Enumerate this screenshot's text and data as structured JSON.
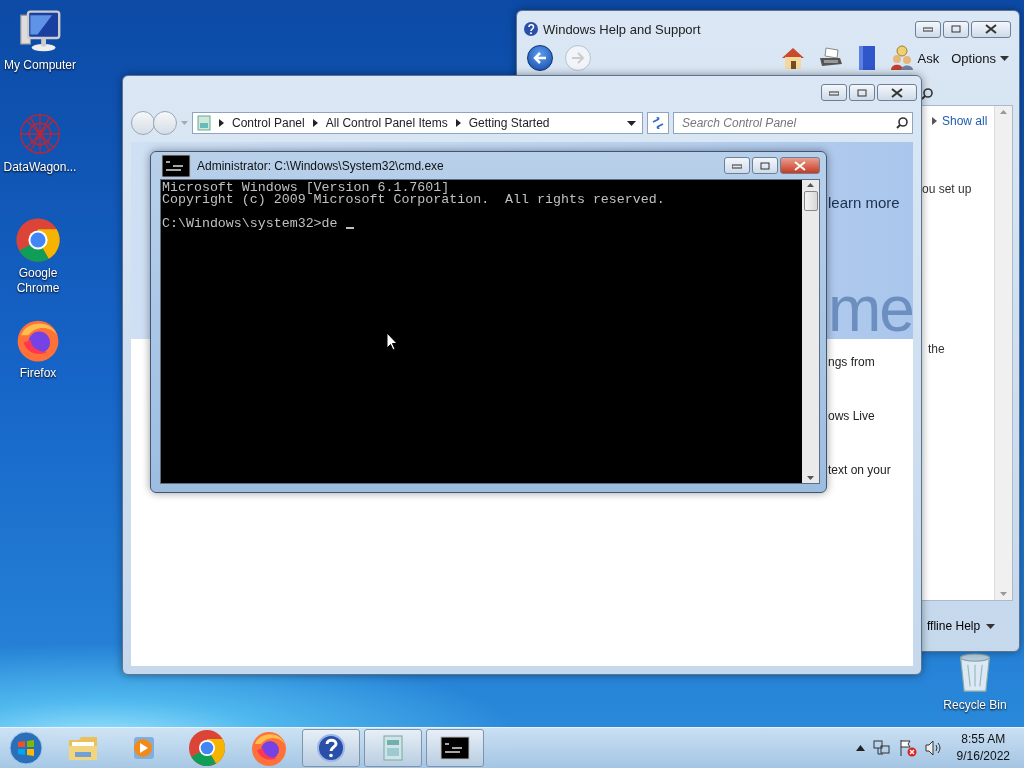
{
  "desktop_icons": [
    {
      "kind": "computer",
      "label": "My Computer"
    },
    {
      "kind": "network",
      "label": "DataWagon..."
    },
    {
      "kind": "chrome",
      "label": "Google Chrome"
    },
    {
      "kind": "firefox",
      "label": "Firefox"
    },
    {
      "kind": "recycle",
      "label": "Recycle Bin"
    }
  ],
  "help_window": {
    "title": "Windows Help and Support",
    "ask_label": "Ask",
    "options_label": "Options",
    "show_all": "Show all",
    "texts": [
      "ou set up",
      "the"
    ],
    "footer": "ffline Help"
  },
  "control_panel": {
    "breadcrumb": [
      "Control Panel",
      "All Control Panel Items",
      "Getting Started"
    ],
    "search": {
      "placeholder": "Search Control Panel"
    },
    "banner_link": "learn more",
    "banner_heading": "me",
    "texts": [
      "ngs from",
      "ows Live",
      "text on your"
    ]
  },
  "cmd_window": {
    "title": "Administrator: C:\\Windows\\System32\\cmd.exe",
    "output": [
      "Microsoft Windows [Version 6.1.7601]",
      "Copyright (c) 2009 Microsoft Corporation.  All rights reserved."
    ],
    "prompt": "C:\\Windows\\system32>de"
  },
  "taskbar": {
    "items": [
      {
        "kind": "start",
        "open": false
      },
      {
        "kind": "explorer",
        "open": false
      },
      {
        "kind": "media",
        "open": false
      },
      {
        "kind": "chrome",
        "open": false
      },
      {
        "kind": "firefox",
        "open": false
      },
      {
        "kind": "help",
        "open": true
      },
      {
        "kind": "control",
        "open": true
      },
      {
        "kind": "cmd",
        "open": true
      }
    ],
    "clock": {
      "time": "8:55 AM",
      "date": "9/16/2022"
    }
  }
}
